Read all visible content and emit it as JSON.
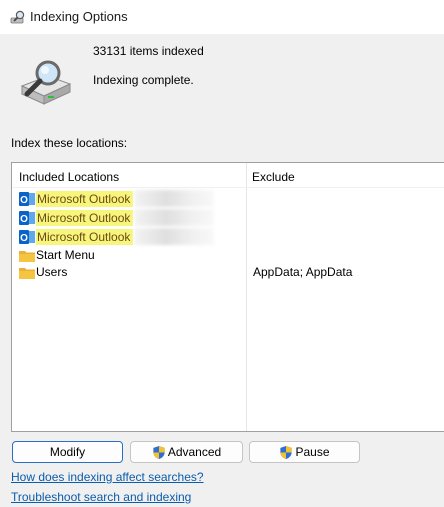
{
  "window": {
    "title": "Indexing Options"
  },
  "status": {
    "count_label": "33131 items indexed",
    "message": "Indexing complete."
  },
  "locations": {
    "section_label": "Index these locations:",
    "headers": {
      "included": "Included Locations",
      "exclude": "Exclude"
    },
    "rows": [
      {
        "label": "Microsoft Outlook",
        "icon": "outlook-icon",
        "highlighted": true,
        "exclude": ""
      },
      {
        "label": "Microsoft Outlook",
        "icon": "outlook-icon",
        "highlighted": true,
        "exclude": ""
      },
      {
        "label": "Microsoft Outlook",
        "icon": "outlook-icon",
        "highlighted": true,
        "exclude": ""
      },
      {
        "label": "Start Menu",
        "icon": "folder-icon",
        "highlighted": false,
        "exclude": ""
      },
      {
        "label": "Users",
        "icon": "folder-icon",
        "highlighted": false,
        "exclude": "AppData; AppData"
      }
    ]
  },
  "buttons": {
    "modify": "Modify",
    "advanced": "Advanced",
    "pause": "Pause"
  },
  "links": {
    "help": "How does indexing affect searches?",
    "troubleshoot": "Troubleshoot search and indexing"
  },
  "colors": {
    "highlight": "#f7f57c",
    "link": "#0b5cad",
    "primary_border": "#2a6ec8",
    "outlook_blue": "#0a64c8",
    "folder_yellow": "#f5c542"
  }
}
